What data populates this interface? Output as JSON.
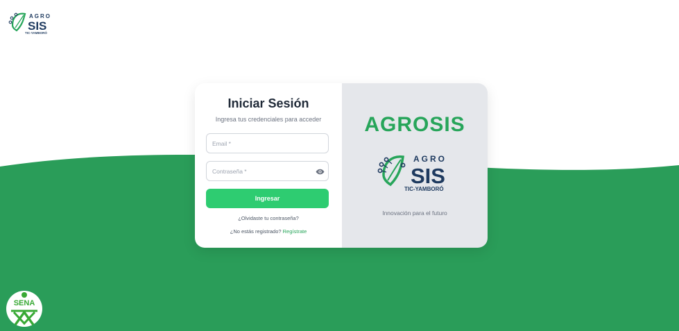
{
  "brand": {
    "logo_top": "AGRO",
    "logo_main": "SIS",
    "logo_bottom": "TIC-YAMBORÓ",
    "name": "AGROSIS",
    "tagline": "Innovación para el futuro",
    "sena_text": "SENA"
  },
  "login": {
    "title": "Iniciar Sesión",
    "subtitle": "Ingresa tus credenciales para acceder",
    "email_placeholder": "Email *",
    "email_value": "",
    "password_placeholder": "Contraseña *",
    "password_value": "",
    "submit_label": "Ingresar",
    "forgot_label": "¿Olvidaste tu contraseña?",
    "register_prompt": "¿No estás registrado?",
    "register_link": "Regístrate"
  },
  "icons": {
    "show_password": "eye-icon",
    "top_logo": "agrosis-leaf-logo",
    "sena": "sena-logo"
  },
  "colors": {
    "accent": "#27a55a",
    "button": "#2ecc71",
    "wave": "#2a9d59",
    "navy": "#1e3a5f",
    "panel": "#e5e7eb"
  }
}
